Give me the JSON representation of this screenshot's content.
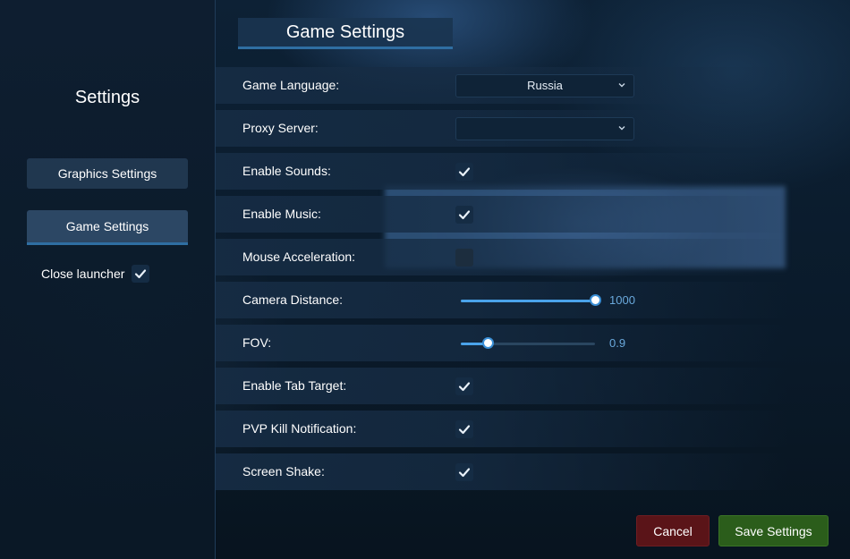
{
  "sidebar": {
    "title": "Settings",
    "items": [
      {
        "label": "Graphics Settings",
        "active": false
      },
      {
        "label": "Game Settings",
        "active": true
      }
    ],
    "close_launcher": {
      "label": "Close launcher",
      "checked": true
    }
  },
  "main": {
    "title": "Game Settings",
    "settings": [
      {
        "label": "Game Language:",
        "type": "select",
        "value": "Russia"
      },
      {
        "label": "Proxy Server:",
        "type": "select",
        "value": ""
      },
      {
        "label": "Enable Sounds:",
        "type": "checkbox",
        "checked": true
      },
      {
        "label": "Enable Music:",
        "type": "checkbox",
        "checked": true
      },
      {
        "label": "Mouse Acceleration:",
        "type": "checkbox",
        "checked": false
      },
      {
        "label": "Camera Distance:",
        "type": "slider",
        "value": "1000",
        "fraction": 1.0
      },
      {
        "label": "FOV:",
        "type": "slider",
        "value": "0.9",
        "fraction": 0.2
      },
      {
        "label": "Enable Tab Target:",
        "type": "checkbox",
        "checked": true
      },
      {
        "label": "PVP Kill Notification:",
        "type": "checkbox",
        "checked": true
      },
      {
        "label": "Screen Shake:",
        "type": "checkbox",
        "checked": true
      }
    ]
  },
  "footer": {
    "cancel_label": "Cancel",
    "save_label": "Save Settings"
  },
  "icons": {
    "check": "check-icon",
    "chevron": "chevron-down-icon"
  },
  "colors": {
    "accent": "#2f6ea2",
    "slider_fill": "#4aa3ea",
    "cancel": "#5a1418",
    "save": "#2b5d1b"
  }
}
